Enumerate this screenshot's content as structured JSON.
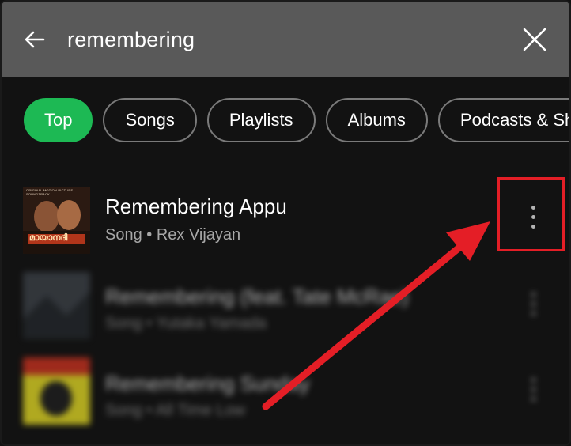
{
  "search": {
    "query": "remembering",
    "back_icon": "back-arrow-icon",
    "clear_icon": "close-icon"
  },
  "filters": [
    {
      "label": "Top",
      "active": true
    },
    {
      "label": "Songs",
      "active": false
    },
    {
      "label": "Playlists",
      "active": false
    },
    {
      "label": "Albums",
      "active": false
    },
    {
      "label": "Podcasts & Sho",
      "active": false
    }
  ],
  "results": [
    {
      "title": "Remembering Appu",
      "subtitle": "Song • Rex Vijayan",
      "art_text": "മായാനദി",
      "art_caption": "ORIGINAL MOTION PICTURE SOUNDTRACK"
    },
    {
      "title": "Remembering (feat. Tate McRae)",
      "subtitle": "Song • Yutaka Yamada"
    },
    {
      "title": "Remembering Sunday",
      "subtitle": "Song • All Time Low"
    }
  ],
  "colors": {
    "accent": "#1DB954",
    "annotation": "#E41E26",
    "search_bar": "#595959",
    "background": "#121212"
  }
}
